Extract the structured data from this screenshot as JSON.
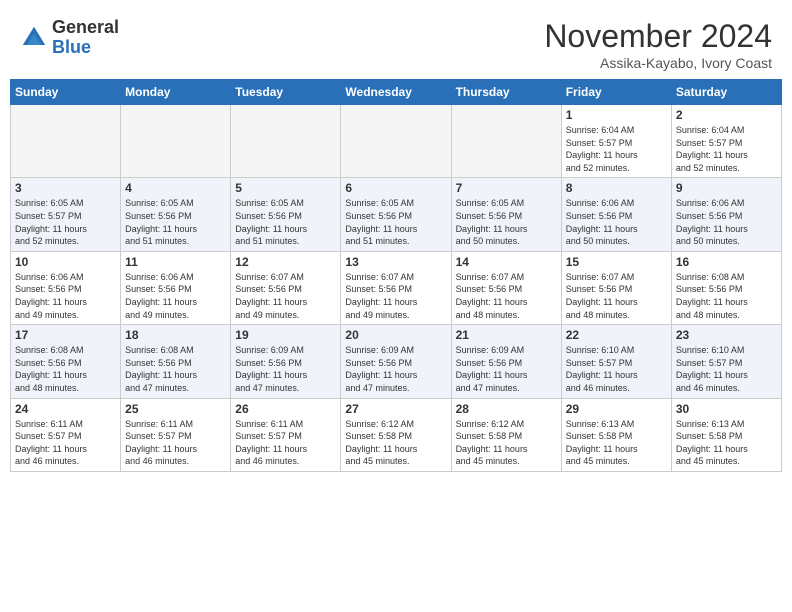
{
  "header": {
    "logo_line1": "General",
    "logo_line2": "Blue",
    "month": "November 2024",
    "location": "Assika-Kayabo, Ivory Coast"
  },
  "weekdays": [
    "Sunday",
    "Monday",
    "Tuesday",
    "Wednesday",
    "Thursday",
    "Friday",
    "Saturday"
  ],
  "weeks": [
    [
      {
        "day": "",
        "info": ""
      },
      {
        "day": "",
        "info": ""
      },
      {
        "day": "",
        "info": ""
      },
      {
        "day": "",
        "info": ""
      },
      {
        "day": "",
        "info": ""
      },
      {
        "day": "1",
        "info": "Sunrise: 6:04 AM\nSunset: 5:57 PM\nDaylight: 11 hours\nand 52 minutes."
      },
      {
        "day": "2",
        "info": "Sunrise: 6:04 AM\nSunset: 5:57 PM\nDaylight: 11 hours\nand 52 minutes."
      }
    ],
    [
      {
        "day": "3",
        "info": "Sunrise: 6:05 AM\nSunset: 5:57 PM\nDaylight: 11 hours\nand 52 minutes."
      },
      {
        "day": "4",
        "info": "Sunrise: 6:05 AM\nSunset: 5:56 PM\nDaylight: 11 hours\nand 51 minutes."
      },
      {
        "day": "5",
        "info": "Sunrise: 6:05 AM\nSunset: 5:56 PM\nDaylight: 11 hours\nand 51 minutes."
      },
      {
        "day": "6",
        "info": "Sunrise: 6:05 AM\nSunset: 5:56 PM\nDaylight: 11 hours\nand 51 minutes."
      },
      {
        "day": "7",
        "info": "Sunrise: 6:05 AM\nSunset: 5:56 PM\nDaylight: 11 hours\nand 50 minutes."
      },
      {
        "day": "8",
        "info": "Sunrise: 6:06 AM\nSunset: 5:56 PM\nDaylight: 11 hours\nand 50 minutes."
      },
      {
        "day": "9",
        "info": "Sunrise: 6:06 AM\nSunset: 5:56 PM\nDaylight: 11 hours\nand 50 minutes."
      }
    ],
    [
      {
        "day": "10",
        "info": "Sunrise: 6:06 AM\nSunset: 5:56 PM\nDaylight: 11 hours\nand 49 minutes."
      },
      {
        "day": "11",
        "info": "Sunrise: 6:06 AM\nSunset: 5:56 PM\nDaylight: 11 hours\nand 49 minutes."
      },
      {
        "day": "12",
        "info": "Sunrise: 6:07 AM\nSunset: 5:56 PM\nDaylight: 11 hours\nand 49 minutes."
      },
      {
        "day": "13",
        "info": "Sunrise: 6:07 AM\nSunset: 5:56 PM\nDaylight: 11 hours\nand 49 minutes."
      },
      {
        "day": "14",
        "info": "Sunrise: 6:07 AM\nSunset: 5:56 PM\nDaylight: 11 hours\nand 48 minutes."
      },
      {
        "day": "15",
        "info": "Sunrise: 6:07 AM\nSunset: 5:56 PM\nDaylight: 11 hours\nand 48 minutes."
      },
      {
        "day": "16",
        "info": "Sunrise: 6:08 AM\nSunset: 5:56 PM\nDaylight: 11 hours\nand 48 minutes."
      }
    ],
    [
      {
        "day": "17",
        "info": "Sunrise: 6:08 AM\nSunset: 5:56 PM\nDaylight: 11 hours\nand 48 minutes."
      },
      {
        "day": "18",
        "info": "Sunrise: 6:08 AM\nSunset: 5:56 PM\nDaylight: 11 hours\nand 47 minutes."
      },
      {
        "day": "19",
        "info": "Sunrise: 6:09 AM\nSunset: 5:56 PM\nDaylight: 11 hours\nand 47 minutes."
      },
      {
        "day": "20",
        "info": "Sunrise: 6:09 AM\nSunset: 5:56 PM\nDaylight: 11 hours\nand 47 minutes."
      },
      {
        "day": "21",
        "info": "Sunrise: 6:09 AM\nSunset: 5:56 PM\nDaylight: 11 hours\nand 47 minutes."
      },
      {
        "day": "22",
        "info": "Sunrise: 6:10 AM\nSunset: 5:57 PM\nDaylight: 11 hours\nand 46 minutes."
      },
      {
        "day": "23",
        "info": "Sunrise: 6:10 AM\nSunset: 5:57 PM\nDaylight: 11 hours\nand 46 minutes."
      }
    ],
    [
      {
        "day": "24",
        "info": "Sunrise: 6:11 AM\nSunset: 5:57 PM\nDaylight: 11 hours\nand 46 minutes."
      },
      {
        "day": "25",
        "info": "Sunrise: 6:11 AM\nSunset: 5:57 PM\nDaylight: 11 hours\nand 46 minutes."
      },
      {
        "day": "26",
        "info": "Sunrise: 6:11 AM\nSunset: 5:57 PM\nDaylight: 11 hours\nand 46 minutes."
      },
      {
        "day": "27",
        "info": "Sunrise: 6:12 AM\nSunset: 5:58 PM\nDaylight: 11 hours\nand 45 minutes."
      },
      {
        "day": "28",
        "info": "Sunrise: 6:12 AM\nSunset: 5:58 PM\nDaylight: 11 hours\nand 45 minutes."
      },
      {
        "day": "29",
        "info": "Sunrise: 6:13 AM\nSunset: 5:58 PM\nDaylight: 11 hours\nand 45 minutes."
      },
      {
        "day": "30",
        "info": "Sunrise: 6:13 AM\nSunset: 5:58 PM\nDaylight: 11 hours\nand 45 minutes."
      }
    ]
  ]
}
